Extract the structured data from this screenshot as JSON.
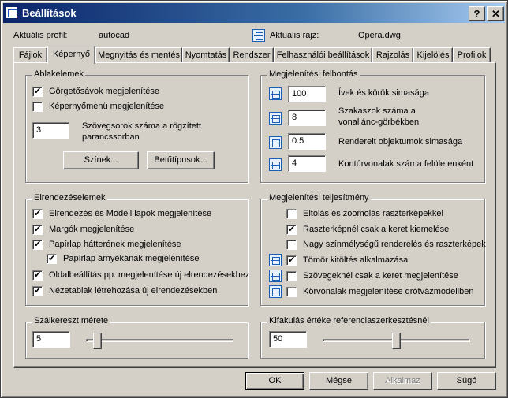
{
  "window": {
    "title": "Beállítások",
    "help_button": "?",
    "close_button": "✕"
  },
  "header": {
    "profile_label": "Aktuális profil:",
    "profile_value": "autocad",
    "drawing_label": "Aktuális rajz:",
    "drawing_value": "Opera.dwg"
  },
  "tabs": [
    {
      "label": "Fájlok"
    },
    {
      "label": "Képernyő",
      "active": true
    },
    {
      "label": "Megnyitás és mentés"
    },
    {
      "label": "Nyomtatás"
    },
    {
      "label": "Rendszer"
    },
    {
      "label": "Felhasználói beállítások"
    },
    {
      "label": "Rajzolás"
    },
    {
      "label": "Kijelölés"
    },
    {
      "label": "Profilok"
    }
  ],
  "window_elements": {
    "title": "Ablakelemek",
    "options": [
      {
        "label": "Görgetősávok megjelenítése",
        "checked": true
      },
      {
        "label": "Képernyőmenü megjelenítése",
        "checked": false
      }
    ],
    "text_lines_value": "3",
    "text_lines_label_1": "Szövegsorok száma a rögzített",
    "text_lines_label_2": "parancssorban",
    "colors_button": "Színek...",
    "fonts_button": "Betűtípusok..."
  },
  "display_resolution": {
    "title": "Megjelenítési felbontás",
    "items": [
      {
        "value": "100",
        "label_1": "Ívek és körök simasága",
        "label_2": ""
      },
      {
        "value": "8",
        "label_1": "Szakaszok száma a",
        "label_2": "vonallánc-görbékben"
      },
      {
        "value": "0.5",
        "label_1": "Renderelt objektumok simasága",
        "label_2": ""
      },
      {
        "value": "4",
        "label_1": "Kontúrvonalak száma felületenként",
        "label_2": ""
      }
    ]
  },
  "layout_elements": {
    "title": "Elrendezéselemek",
    "options": [
      {
        "label": "Elrendezés és Modell lapok megjelenítése",
        "checked": true
      },
      {
        "label": "Margók megjelenítése",
        "checked": true
      },
      {
        "label": "Papírlap hátterének megjelenítése",
        "checked": true
      },
      {
        "label": "Papírlap árnyékának megjelenítése",
        "checked": true
      },
      {
        "label": "Oldalbeállítás pp. megjelenítése új elrendezésekhez",
        "checked": true
      },
      {
        "label": "Nézetablak létrehozása új elrendezésekben",
        "checked": true
      }
    ]
  },
  "display_performance": {
    "title": "Megjelenítési teljesítmény",
    "options": [
      {
        "label": "Eltolás és zoomolás raszterképekkel",
        "checked": false,
        "icon": false
      },
      {
        "label": "Raszterképnél csak a  keret kiemelése",
        "checked": true,
        "icon": false
      },
      {
        "label": "Nagy színmélységű renderelés és raszterképek",
        "checked": false,
        "icon": false
      },
      {
        "label": "Tömör kitöltés alkalmazása",
        "checked": true,
        "icon": true
      },
      {
        "label": "Szövegeknél csak a keret megjelenítése",
        "checked": false,
        "icon": true
      },
      {
        "label": "Körvonalak megjelenítése drótvázmodellben",
        "checked": false,
        "icon": true
      }
    ]
  },
  "crosshair": {
    "title": "Szálkereszt mérete",
    "value": "5",
    "slider_level_percent": 5
  },
  "fade": {
    "title": "Kifakulás értéke referenciaszerkesztésnél",
    "value": "50",
    "slider_level_percent": 50
  },
  "buttons": {
    "ok": "OK",
    "cancel": "Mégse",
    "apply": "Alkalmaz",
    "help": "Súgó"
  }
}
